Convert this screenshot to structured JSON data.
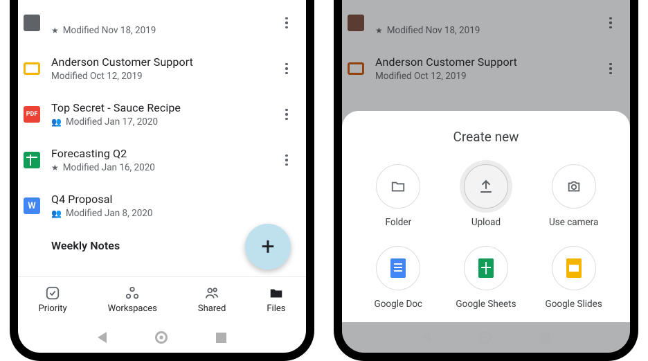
{
  "leftPhone": {
    "files": [
      {
        "title": "…",
        "subPrefix": "star",
        "sub": "Modified Nov 18, 2019"
      },
      {
        "title": "Anderson Customer Support",
        "subPrefix": "",
        "sub": "Modified Oct 12, 2019"
      },
      {
        "title": "Top Secret - Sauce Recipe",
        "subPrefix": "shared",
        "sub": "Modified Jan 17, 2020"
      },
      {
        "title": "Forecasting Q2",
        "subPrefix": "star",
        "sub": "Modified Jan 16, 2020"
      },
      {
        "title": "Q4 Proposal",
        "subPrefix": "shared",
        "sub": "Modified Jan 8, 2020"
      },
      {
        "title": "Weekly Notes",
        "subPrefix": "",
        "sub": ""
      }
    ],
    "nav": {
      "priority": "Priority",
      "workspaces": "Workspaces",
      "shared": "Shared",
      "files": "Files"
    }
  },
  "rightPhone": {
    "bgFiles": [
      {
        "title": "…",
        "sub": "Modified Nov 18, 2019"
      },
      {
        "title": "Anderson Customer Support",
        "sub": "Modified Oct 12, 2019"
      }
    ],
    "sheetTitle": "Create new",
    "items": {
      "folder": "Folder",
      "upload": "Upload",
      "camera": "Use camera",
      "doc": "Google Doc",
      "sheets": "Google Sheets",
      "slides": "Google Slides"
    }
  }
}
